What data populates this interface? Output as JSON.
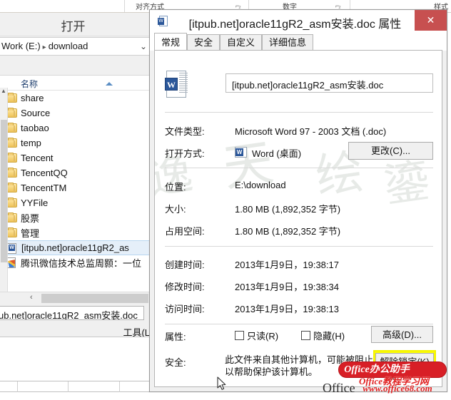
{
  "background_app": {
    "ribbon_groups": [
      "对齐方式",
      "数字",
      "样式"
    ]
  },
  "open_dialog": {
    "title": "打开",
    "breadcrumb": {
      "drive": "Work (E:)",
      "separator": "▸",
      "folder": "download",
      "chevron": "⌄"
    },
    "column_header": "名称",
    "items": [
      {
        "label": "share",
        "icon": "folder-icon",
        "type": "folder"
      },
      {
        "label": "Source",
        "icon": "folder-icon",
        "type": "folder"
      },
      {
        "label": "taobao",
        "icon": "folder-icon",
        "type": "folder"
      },
      {
        "label": "temp",
        "icon": "folder-icon",
        "type": "folder"
      },
      {
        "label": "Tencent",
        "icon": "folder-icon",
        "type": "folder"
      },
      {
        "label": "TencentQQ",
        "icon": "folder-icon",
        "type": "folder"
      },
      {
        "label": "TencentTM",
        "icon": "folder-icon",
        "type": "folder"
      },
      {
        "label": "YYFile",
        "icon": "folder-icon",
        "type": "folder"
      },
      {
        "label": "股票",
        "icon": "folder-icon",
        "type": "folder"
      },
      {
        "label": "管理",
        "icon": "folder-icon",
        "type": "folder"
      },
      {
        "label": "[itpub.net]oracle11gR2_as",
        "icon": "word-document-icon",
        "type": "word",
        "selected": true
      },
      {
        "label": "腾讯微信技术总监周颢：一位",
        "icon": "text-document-icon",
        "type": "text"
      }
    ],
    "filename_value": "ub.net]oracle11gR2_asm安装.doc",
    "tools_label": "工具(L",
    "hscroll_left_arrow": "‹"
  },
  "properties_dialog": {
    "title": "[itpub.net]oracle11gR2_asm安装.doc 属性",
    "title_icon": "word-document-icon",
    "close_label": "✕",
    "close_color": "#c75050",
    "tabs": [
      {
        "label": "常规",
        "active": true
      },
      {
        "label": "安全",
        "active": false
      },
      {
        "label": "自定义",
        "active": false
      },
      {
        "label": "详细信息",
        "active": false
      }
    ],
    "filename_field": "[itpub.net]oracle11gR2_asm安装.doc",
    "rows": [
      {
        "label": "文件类型:",
        "value": "Microsoft Word 97 - 2003 文档 (.doc)"
      },
      {
        "label": "打开方式:",
        "value": "Word (桌面)"
      },
      {
        "label": "位置:",
        "value": "E:\\download"
      },
      {
        "label": "大小:",
        "value": "1.80 MB (1,892,352 字节)"
      },
      {
        "label": "占用空间:",
        "value": "1.80 MB (1,892,352 字节)"
      },
      {
        "label": "创建时间:",
        "value": "2013年1月9日，19:38:17"
      },
      {
        "label": "修改时间:",
        "value": "2013年1月9日，19:38:34"
      },
      {
        "label": "访问时间:",
        "value": "2013年1月9日，19:38:13"
      }
    ],
    "change_button": "更改(C)...",
    "attributes_label": "属性:",
    "checkbox_readonly": "只读(R)",
    "checkbox_hidden": "隐藏(H)",
    "advanced_button": "高级(D)...",
    "security_label": "安全:",
    "security_text": "此文件来自其他计算机，可能被阻止以帮助保护该计算机。",
    "unlock_button": "解除锁定(K)",
    "highlight_color": "#ffff00"
  },
  "watermark": {
    "page_text": "逸夫 绘鎏",
    "logo_line1": "Office办公助手",
    "logo_line2": "Office教程学习网",
    "logo_line3_left": "Office",
    "logo_line3_right": "m",
    "logo_url": "www.office68.com"
  }
}
